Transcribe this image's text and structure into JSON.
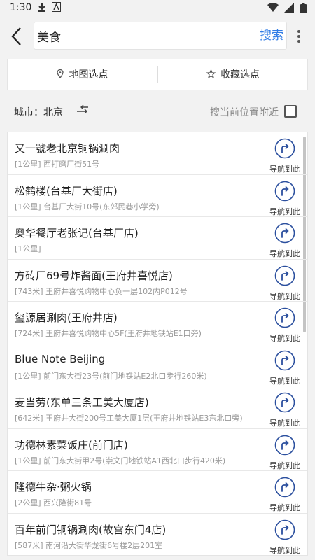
{
  "status": {
    "time": "1:30",
    "icons_left": [
      "download-icon",
      "app-icon"
    ],
    "icons_right": [
      "wifi-icon",
      "signal-icon",
      "battery-icon"
    ]
  },
  "header": {
    "search_value": "美食",
    "search_button": "搜索"
  },
  "tabs": [
    {
      "label": "地图选点",
      "icon": "pin-icon"
    },
    {
      "label": "收藏选点",
      "icon": "star-icon"
    }
  ],
  "filter": {
    "city": "城市：北京",
    "nearby_label": "搜当前位置附近",
    "nearby_checked": false
  },
  "nav_label": "导航到此",
  "results": [
    {
      "name": "又一號老北京铜锅涮肉",
      "distance": "[1公里]",
      "address": "西打磨厂街51号"
    },
    {
      "name": "松鹤楼(台基厂大街店)",
      "distance": "[1公里]",
      "address": "台基厂大街10号(东郊民巷小学旁)"
    },
    {
      "name": "奥华餐厅老张记(台基厂店)",
      "distance": "[1公里]",
      "address": ""
    },
    {
      "name": "方砖厂69号炸酱面(王府井喜悦店)",
      "distance": "[743米]",
      "address": "王府井喜悦购物中心负一层102内P012号"
    },
    {
      "name": "玺源居涮肉(王府井店)",
      "distance": "[724米]",
      "address": "王府井喜悦购物中心5F(王府井地铁站E1口旁)"
    },
    {
      "name": "Blue Note Beijing",
      "distance": "[1公里]",
      "address": "前门东大街23号(前门地铁站E2北口步行260米)"
    },
    {
      "name": "麦当劳(东单三条工美大厦店)",
      "distance": "[642米]",
      "address": "王府井大街200号工美大厦1层(王府井地铁站E3东北口旁)"
    },
    {
      "name": "功德林素菜饭庄(前门店)",
      "distance": "[1公里]",
      "address": "前门东大街甲2号(崇文门地铁站A1西北口步行420米)"
    },
    {
      "name": "隆德牛杂·粥火锅",
      "distance": "[2公里]",
      "address": "西兴隆街81号"
    },
    {
      "name": "百年前门铜锅涮肉(故宫东门4店)",
      "distance": "[587米]",
      "address": "南河沿大街华龙街6号楼2层201室"
    }
  ],
  "colors": {
    "accent": "#2f7be5",
    "nav_icon": "#2b4f9e"
  }
}
